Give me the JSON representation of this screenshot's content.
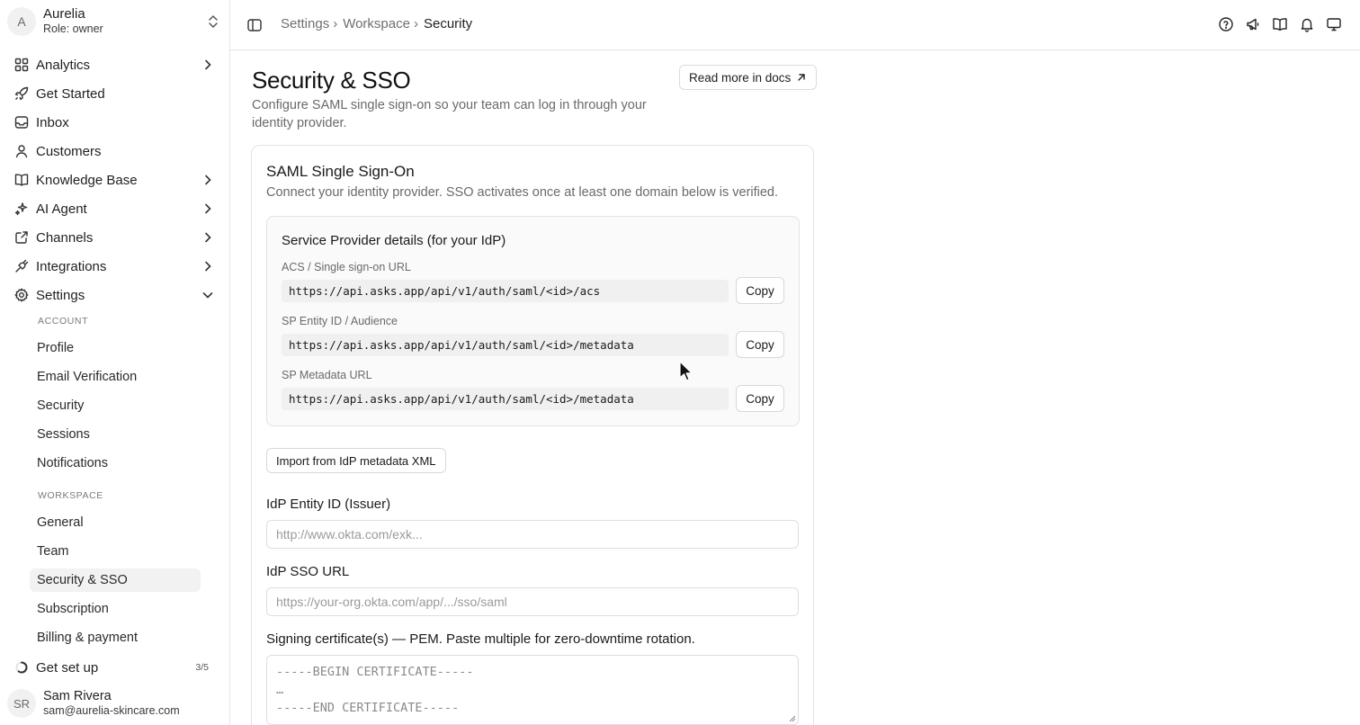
{
  "sidebar": {
    "org": {
      "initial": "A",
      "name": "Aurelia",
      "role": "Role: owner"
    },
    "nav": [
      {
        "label": "Analytics",
        "icon": "grid-icon",
        "chevron": true
      },
      {
        "label": "Get Started",
        "icon": "rocket-icon",
        "chevron": false
      },
      {
        "label": "Inbox",
        "icon": "inbox-icon",
        "chevron": false
      },
      {
        "label": "Customers",
        "icon": "user-icon",
        "chevron": false
      },
      {
        "label": "Knowledge Base",
        "icon": "book-icon",
        "chevron": true
      },
      {
        "label": "AI Agent",
        "icon": "sparkle-icon",
        "chevron": true
      },
      {
        "label": "Channels",
        "icon": "share-icon",
        "chevron": true
      },
      {
        "label": "Integrations",
        "icon": "plug-icon",
        "chevron": true
      },
      {
        "label": "Settings",
        "icon": "gear-icon",
        "chevron": "down"
      }
    ],
    "account_label": "ACCOUNT",
    "account_items": [
      "Profile",
      "Email Verification",
      "Security",
      "Sessions",
      "Notifications"
    ],
    "workspace_label": "WORKSPACE",
    "workspace_items": [
      "General",
      "Team",
      "Security & SSO",
      "Subscription",
      "Billing & payment"
    ],
    "active_item": "Security & SSO",
    "setup": {
      "label": "Get set up",
      "count": "3/5",
      "progress": 0.6
    },
    "user": {
      "initials": "SR",
      "name": "Sam Rivera",
      "email": "sam@aurelia-skincare.com"
    }
  },
  "topbar": {
    "breadcrumbs": [
      "Settings",
      "Workspace",
      "Security"
    ],
    "icons": [
      "help-icon",
      "megaphone-icon",
      "book-open-icon",
      "bell-icon",
      "monitor-icon"
    ]
  },
  "main": {
    "title": "Security & SSO",
    "description": "Configure SAML single sign-on so your team can log in through your identity provider.",
    "docs_button": "Read more in docs",
    "card": {
      "title": "SAML Single Sign-On",
      "description": "Connect your identity provider. SSO activates once at least one domain below is verified.",
      "sp": {
        "title": "Service Provider details (for your IdP)",
        "fields": [
          {
            "label": "ACS / Single sign-on URL",
            "value": "https://api.asks.app/api/v1/auth/saml/<id>/acs"
          },
          {
            "label": "SP Entity ID / Audience",
            "value": "https://api.asks.app/api/v1/auth/saml/<id>/metadata"
          },
          {
            "label": "SP Metadata URL",
            "value": "https://api.asks.app/api/v1/auth/saml/<id>/metadata"
          }
        ],
        "copy_label": "Copy"
      },
      "import_button": "Import from IdP metadata XML",
      "entity_id": {
        "label": "IdP Entity ID (Issuer)",
        "placeholder": "http://www.okta.com/exk..."
      },
      "sso_url": {
        "label": "IdP SSO URL",
        "placeholder": "https://your-org.okta.com/app/.../sso/saml"
      },
      "certificate": {
        "label": "Signing certificate(s) — PEM. Paste multiple for zero-downtime rotation.",
        "placeholder": "-----BEGIN CERTIFICATE-----\n…\n-----END CERTIFICATE-----"
      }
    }
  }
}
